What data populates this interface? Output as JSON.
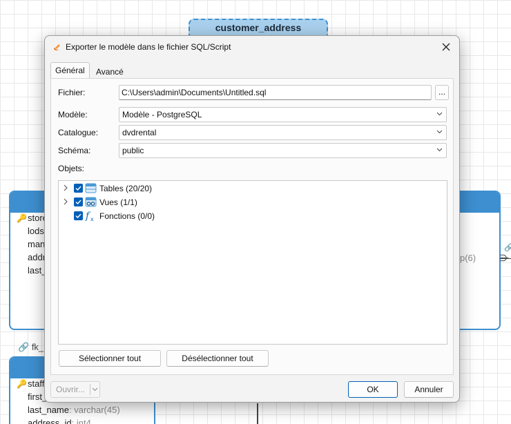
{
  "diagram": {
    "top_entity_title": "customer_address",
    "left_entity_columns": [
      "store",
      "lods",
      "man",
      "addr",
      "last_"
    ],
    "right_entity_fragment": "p(6)",
    "link_label": "fk_",
    "bottom_entity_columns": [
      {
        "name": "staff",
        "type": ""
      },
      {
        "name": "first_",
        "type": ""
      },
      {
        "name": "last_name",
        "type": ": varchar(45)"
      },
      {
        "name": "address_id",
        "type": ": int4"
      }
    ]
  },
  "dialog": {
    "title": "Exporter le modèle dans le fichier SQL/Script",
    "close_icon": "close-icon",
    "tabs": [
      {
        "label": "Général",
        "active": true
      },
      {
        "label": "Avancé",
        "active": false
      }
    ],
    "fields": {
      "fichier_label": "Fichier:",
      "fichier_value": "C:\\Users\\admin\\Documents\\Untitled.sql",
      "browse_label": "...",
      "modele_label": "Modèle:",
      "modele_value": "Modèle - PostgreSQL",
      "catalogue_label": "Catalogue:",
      "catalogue_value": "dvdrental",
      "schema_label": "Schéma:",
      "schema_value": "public",
      "objets_label": "Objets:"
    },
    "objects": [
      {
        "label": "Tables  (20/20)",
        "icon": "table-icon",
        "expandable": true,
        "checked": true
      },
      {
        "label": "Vues  (1/1)",
        "icon": "view-icon",
        "expandable": true,
        "checked": true
      },
      {
        "label": "Fonctions  (0/0)",
        "icon": "function-icon",
        "expandable": false,
        "checked": true
      }
    ],
    "buttons": {
      "select_all": "Sélectionner tout",
      "deselect_all": "Désélectionner tout",
      "open": "Ouvrir...",
      "ok": "OK",
      "cancel": "Annuler"
    },
    "colors": {
      "accent": "#005fb8",
      "entity_header": "#3d8fd0",
      "entity_selected_fill": "#a9d1ee"
    }
  }
}
